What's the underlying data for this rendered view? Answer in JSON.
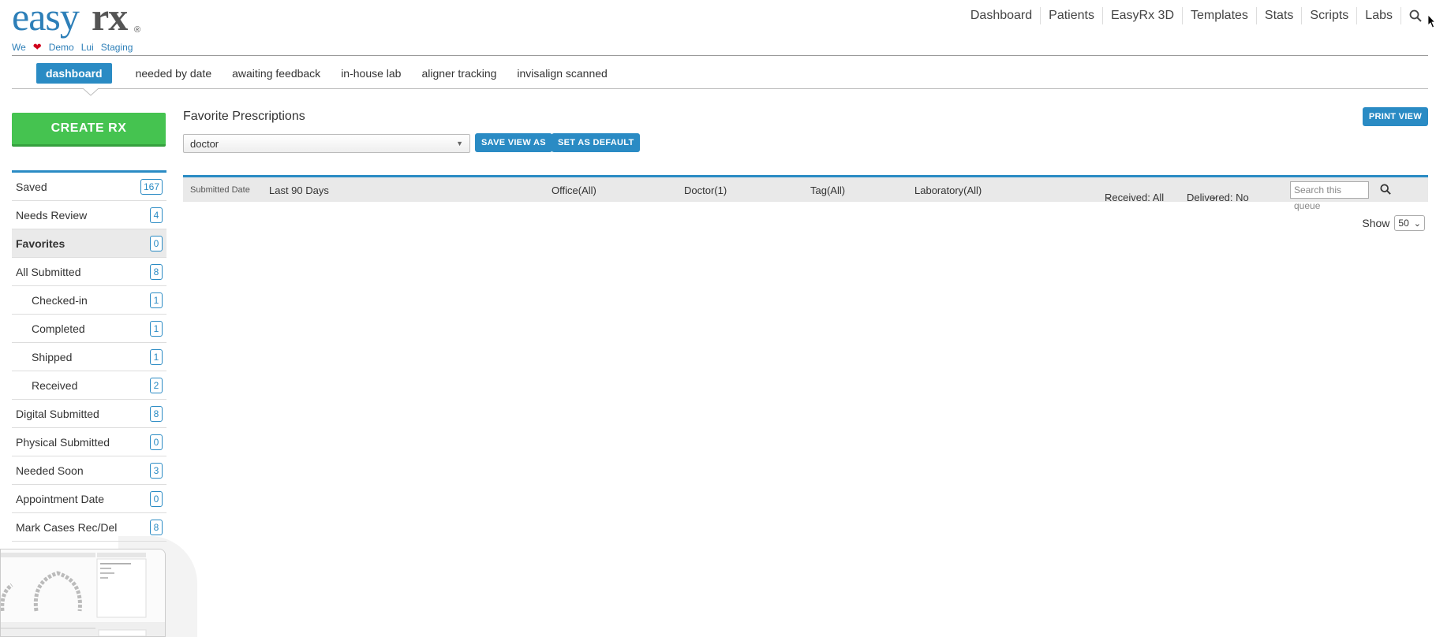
{
  "header": {
    "logo_part1": "easy",
    "logo_part2": "rx",
    "logo_mark": "®",
    "sublinks": [
      "We",
      "Demo",
      "Lui",
      "Staging"
    ],
    "heart_icon": "heart-icon",
    "nav": [
      "Dashboard",
      "Patients",
      "EasyRx 3D",
      "Templates",
      "Stats",
      "Scripts",
      "Labs"
    ],
    "search_icon": "search-icon"
  },
  "tabs": [
    {
      "label": "dashboard",
      "active": true
    },
    {
      "label": "needed by date",
      "active": false
    },
    {
      "label": "awaiting feedback",
      "active": false
    },
    {
      "label": "in-house lab",
      "active": false
    },
    {
      "label": "aligner tracking",
      "active": false
    },
    {
      "label": "invisalign scanned",
      "active": false
    }
  ],
  "sidebar": {
    "create_label": "CREATE RX",
    "items": [
      {
        "label": "Saved",
        "count": "167",
        "sub": false,
        "active": false
      },
      {
        "label": "Needs Review",
        "count": "4",
        "sub": false,
        "active": false
      },
      {
        "label": "Favorites",
        "count": "0",
        "sub": false,
        "active": true
      },
      {
        "label": "All Submitted",
        "count": "8",
        "sub": false,
        "active": false
      },
      {
        "label": "Checked-in",
        "count": "1",
        "sub": true,
        "active": false
      },
      {
        "label": "Completed",
        "count": "1",
        "sub": true,
        "active": false
      },
      {
        "label": "Shipped",
        "count": "1",
        "sub": true,
        "active": false
      },
      {
        "label": "Received",
        "count": "2",
        "sub": true,
        "active": false
      },
      {
        "label": "Digital Submitted",
        "count": "8",
        "sub": false,
        "active": false
      },
      {
        "label": "Physical Submitted",
        "count": "0",
        "sub": false,
        "active": false
      },
      {
        "label": "Needed Soon",
        "count": "3",
        "sub": false,
        "active": false
      },
      {
        "label": "Appointment Date",
        "count": "0",
        "sub": false,
        "active": false
      },
      {
        "label": "Mark Cases Rec/Del",
        "count": "8",
        "sub": false,
        "active": false
      }
    ]
  },
  "main": {
    "title": "Favorite Prescriptions",
    "view_value": "doctor",
    "save_view_label": "SAVE VIEW AS",
    "set_default_label": "SET AS DEFAULT",
    "print_view_label": "PRINT VIEW",
    "filters": {
      "submitted_label": "Submitted Date",
      "date_range": "Last 90 Days",
      "office": "Office(All)",
      "doctor": "Doctor(1)",
      "tag": "Tag(All)",
      "laboratory": "Laboratory(All)",
      "received": "Received: All",
      "delivered": "Delivered: No",
      "search_placeholder": "Search this queue"
    },
    "show_label": "Show",
    "show_value": "50"
  },
  "colors": {
    "brand_blue": "#2a8bc4",
    "create_green": "#45c350",
    "heart_red": "#d0021b"
  }
}
